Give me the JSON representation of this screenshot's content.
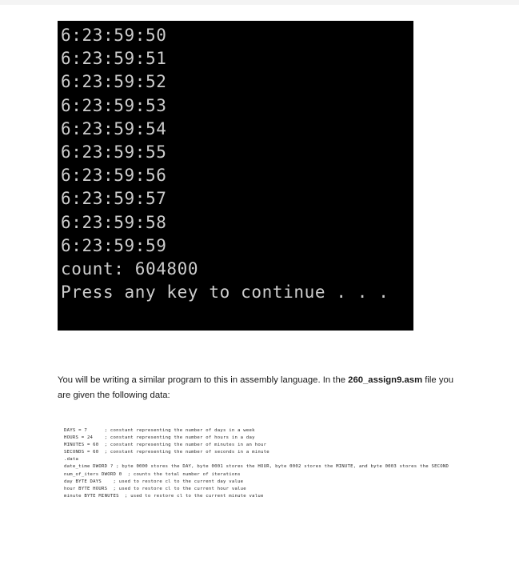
{
  "page": {
    "background_color": "#ffffff",
    "top_strip_color": "#f4f4f4"
  },
  "console": {
    "background_color": "#000000",
    "text_color": "#cccccc",
    "lines": [
      "6:23:59:50",
      "6:23:59:51",
      "6:23:59:52",
      "6:23:59:53",
      "6:23:59:54",
      "6:23:59:55",
      "6:23:59:56",
      "6:23:59:57",
      "6:23:59:58",
      "6:23:59:59",
      "count: 604800",
      "",
      "Press any key to continue . . ."
    ]
  },
  "paragraph": {
    "part1": "You will be writing a similar program to this in assembly language.  In the ",
    "filename": "260_assign9.asm",
    "part2": " file you are given the following data:"
  },
  "code": {
    "lines": [
      "DAYS = 7      ; constant representing the number of days in a week",
      "HOURS = 24    ; constant representing the number of hours in a day",
      "MINUTES = 60  ; constant representing the number of minutes in an hour",
      "SECONDS = 60  ; constant representing the number of seconds in a minute",
      "",
      ".data",
      "",
      "date_time DWORD ? ; byte 0000 stores the DAY, byte 0001 stores the HOUR, byte 0002 stores the MINUTE, and byte 0003 stores the SECOND",
      "num_of_iters DWORD 0  ; counts the total number of iterations",
      "day BYTE DAYS    ; used to restore cl to the current day value",
      "hour BYTE HOURS  ; used to restore cl to the current hour value",
      "minute BYTE MINUTES  ; used to restore cl to the current minute value"
    ]
  }
}
